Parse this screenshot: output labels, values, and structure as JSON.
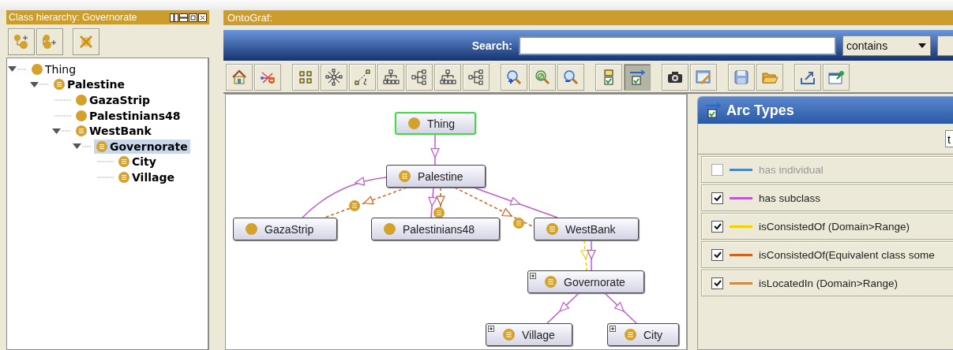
{
  "class_hierarchy": {
    "title": "Class hierarchy: Governorate",
    "toolbar": [
      {
        "kind": "add-subclass"
      },
      {
        "kind": "add-sibling"
      },
      {
        "kind": "delete"
      }
    ],
    "tree": [
      {
        "label": "Thing",
        "kind": "primitive",
        "selected": false,
        "expanded": true,
        "children": [
          {
            "label": "Palestine",
            "kind": "defined",
            "selected": false,
            "expanded": true,
            "children": [
              {
                "label": "GazaStrip",
                "kind": "primitive",
                "selected": false
              },
              {
                "label": "Palestinians48",
                "kind": "primitive",
                "selected": false
              },
              {
                "label": "WestBank",
                "kind": "defined",
                "selected": false,
                "expanded": true,
                "children": [
                  {
                    "label": "Governorate",
                    "kind": "defined",
                    "selected": true,
                    "expanded": true,
                    "children": [
                      {
                        "label": "City",
                        "kind": "defined",
                        "selected": false
                      },
                      {
                        "label": "Village",
                        "kind": "defined",
                        "selected": false
                      }
                    ]
                  }
                ]
              }
            ]
          }
        ]
      }
    ]
  },
  "ontograf": {
    "title": "OntoGraf:",
    "search": {
      "label": "Search:",
      "mode": "contains"
    },
    "toolbar": [
      [
        {
          "kind": "home",
          "selected": false
        },
        {
          "kind": "remove-edges",
          "selected": false
        }
      ],
      [
        {
          "kind": "grid",
          "selected": false
        },
        {
          "kind": "radial",
          "selected": false
        },
        {
          "kind": "spring",
          "selected": false
        },
        {
          "kind": "tree-down",
          "selected": false
        },
        {
          "kind": "tree-right",
          "selected": false
        },
        {
          "kind": "tree-down",
          "selected": false
        },
        {
          "kind": "tree-right",
          "selected": false
        }
      ],
      [
        {
          "kind": "zoom-in",
          "selected": false
        },
        {
          "kind": "zoom-reset",
          "selected": false
        },
        {
          "kind": "zoom-out",
          "selected": false
        }
      ],
      [
        {
          "kind": "node-filter",
          "selected": false
        },
        {
          "kind": "arc-filter",
          "selected": true
        }
      ],
      [
        {
          "kind": "camera",
          "selected": false
        },
        {
          "kind": "edit",
          "selected": false
        }
      ],
      [
        {
          "kind": "save",
          "selected": false
        },
        {
          "kind": "open",
          "selected": false
        }
      ],
      [
        {
          "kind": "export",
          "selected": false
        },
        {
          "kind": "pin",
          "selected": false
        }
      ]
    ],
    "graph": {
      "nodes": [
        {
          "label": "Thing",
          "kind": "primitive",
          "selected": true,
          "expandable": false
        },
        {
          "label": "Palestine",
          "kind": "defined",
          "selected": false,
          "expandable": false
        },
        {
          "label": "GazaStrip",
          "kind": "primitive",
          "selected": false,
          "expandable": false
        },
        {
          "label": "Palestinians48",
          "kind": "primitive",
          "selected": false,
          "expandable": false
        },
        {
          "label": "WestBank",
          "kind": "defined",
          "selected": false,
          "expandable": false
        },
        {
          "label": "Governorate",
          "kind": "defined",
          "selected": false,
          "expandable": true
        },
        {
          "label": "Village",
          "kind": "defined",
          "selected": false,
          "expandable": true
        },
        {
          "label": "City",
          "kind": "defined",
          "selected": false,
          "expandable": true
        }
      ]
    },
    "arc_types": {
      "title": "Arc Types",
      "filter_value": "t",
      "items": [
        {
          "label": "has individual",
          "checked": false,
          "color": "#4a86c4"
        },
        {
          "label": "has subclass",
          "checked": true,
          "color": "#c05ad0"
        },
        {
          "label": "isConsistedOf (Domain>Range)",
          "checked": true,
          "color": "#f2d000"
        },
        {
          "label": "isConsistedOf(Equivalent class some",
          "checked": true,
          "color": "#d2601e"
        },
        {
          "label": "isLocatedIn (Domain>Range)",
          "checked": true,
          "color": "#d08a48"
        }
      ]
    }
  }
}
